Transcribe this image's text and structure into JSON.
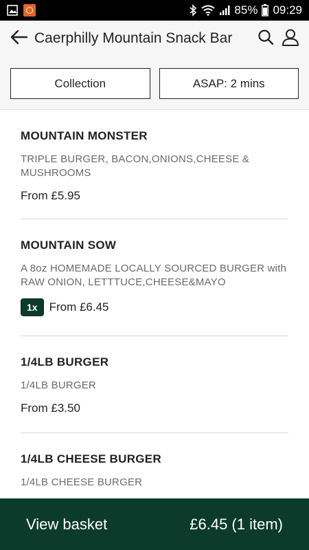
{
  "status_bar": {
    "battery": "85%",
    "time": "09:29",
    "icons": [
      "image-icon",
      "app-notification-icon",
      "bluetooth-icon",
      "wifi-icon",
      "signal-icon",
      "battery-icon"
    ]
  },
  "header": {
    "title": "Caerphilly Mountain Snack Bar",
    "back_icon": "arrow-left-icon",
    "search_icon": "search-icon",
    "account_icon": "user-icon",
    "collection_label": "Collection",
    "time_label": "ASAP: 2 mins"
  },
  "menu": {
    "items": [
      {
        "name": "MOUNTAIN MONSTER",
        "description": "TRIPLE BURGER, BACON,ONIONS,CHEESE & MUSHROOMS",
        "price": "From £5.95",
        "qty": ""
      },
      {
        "name": "MOUNTAIN SOW",
        "description": "A 8oz HOMEMADE LOCALLY SOURCED BURGER with RAW ONION, LETTTUCE,CHEESE&MAYO",
        "price": "From £6.45",
        "qty": "1x"
      },
      {
        "name": "1/4LB BURGER",
        "description": "1/4LB BURGER",
        "price": "From £3.50",
        "qty": ""
      },
      {
        "name": "1/4LB CHEESE BURGER",
        "description": "1/4LB CHEESE BURGER",
        "price": "",
        "qty": ""
      }
    ]
  },
  "basket": {
    "label": "View basket",
    "total": "£6.45 (1 item)"
  },
  "colors": {
    "brand_green": "#0d3b2b",
    "header_bg": "#f6f6f6",
    "status_bar_bg": "#000000",
    "app_icon_orange": "#e0652a"
  }
}
